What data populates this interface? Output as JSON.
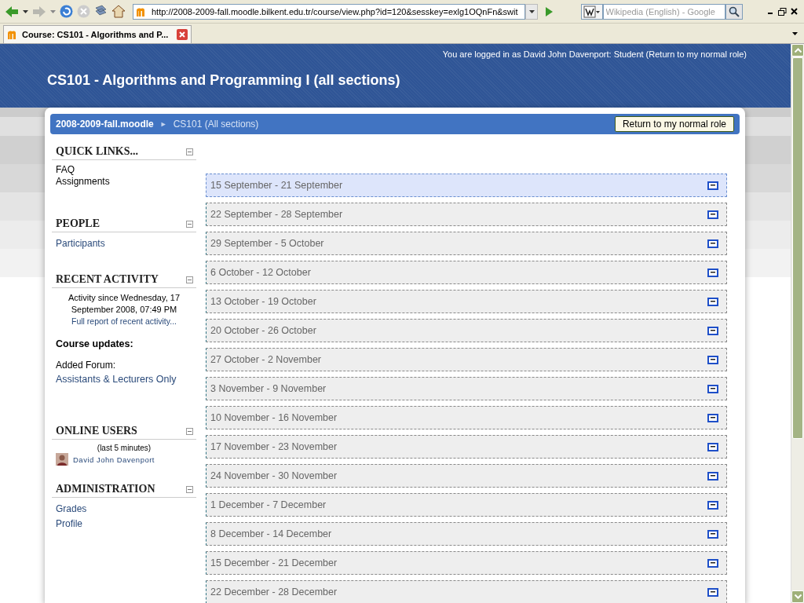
{
  "browser": {
    "url": "http://2008-2009-fall.moodle.bilkent.edu.tr/course/view.php?id=120&sesskey=exlg1OQnFn&swit",
    "search_placeholder": "Wikipedia (English) - Google",
    "tabs": [
      {
        "title": "Course: CS101 - Algorithms and P...",
        "selected": true
      }
    ]
  },
  "header": {
    "login_text": "You are logged in as David John Davenport: Student (Return to my normal role)",
    "course_title": "CS101 - Algorithms and Programming I (all sections)"
  },
  "breadcrumb": {
    "site": "2008-2009-fall.moodle",
    "separator": "►",
    "course": "CS101 (All sections)",
    "button": "Return to my normal role"
  },
  "blocks": [
    {
      "kind": "text",
      "title": "QUICK LINKS...",
      "items": [
        "FAQ",
        "Assignments"
      ]
    },
    {
      "kind": "links",
      "title": "PEOPLE",
      "items": [
        "Participants"
      ]
    },
    {
      "kind": "recent",
      "title": "RECENT ACTIVITY",
      "since": "Activity since Wednesday, 17 September 2008, 07:49 PM",
      "report_link": "Full report of recent activity...",
      "updates_heading": "Course updates:",
      "update_text": "Added Forum:",
      "update_link": "Assistants & Lecturers Only"
    },
    {
      "kind": "users",
      "title": "ONLINE USERS",
      "note": "(last 5 minutes)",
      "users": [
        "David John Davenport"
      ]
    },
    {
      "kind": "links",
      "title": "ADMINISTRATION",
      "items": [
        "Grades",
        "Profile"
      ]
    }
  ],
  "weeks": [
    {
      "label": "15 September - 21 September",
      "current": true
    },
    {
      "label": "22 September - 28 September",
      "current": false
    },
    {
      "label": "29 September - 5 October",
      "current": false
    },
    {
      "label": "6 October - 12 October",
      "current": false
    },
    {
      "label": "13 October - 19 October",
      "current": false
    },
    {
      "label": "20 October - 26 October",
      "current": false
    },
    {
      "label": "27 October - 2 November",
      "current": false
    },
    {
      "label": "3 November - 9 November",
      "current": false
    },
    {
      "label": "10 November - 16 November",
      "current": false
    },
    {
      "label": "17 November - 23 November",
      "current": false
    },
    {
      "label": "24 November - 30 November",
      "current": false
    },
    {
      "label": "1 December - 7 December",
      "current": false
    },
    {
      "label": "8 December - 14 December",
      "current": false
    },
    {
      "label": "15 December - 21 December",
      "current": false
    },
    {
      "label": "22 December - 28 December",
      "current": false
    }
  ]
}
